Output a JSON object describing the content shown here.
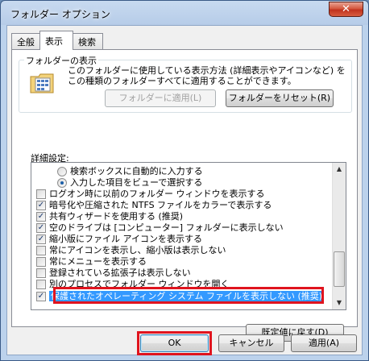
{
  "window": {
    "title": "フォルダー オプション",
    "close_label": "✕"
  },
  "tabs": [
    {
      "label": "全般",
      "active": false
    },
    {
      "label": "表示",
      "active": true
    },
    {
      "label": "検索",
      "active": false
    }
  ],
  "folder_views": {
    "group_label": "フォルダーの表示",
    "description": "このフォルダーに使用している表示方法 (詳細表示やアイコンなど) をこの種類のフォルダーすべてに適用することができます。",
    "apply_button": "フォルダーに適用(L)",
    "reset_button": "フォルダーをリセット(R)"
  },
  "advanced": {
    "label": "詳細設定:",
    "items": [
      {
        "type": "radio",
        "checked": false,
        "text": "検索ボックスに自動的に入力する"
      },
      {
        "type": "radio",
        "checked": true,
        "text": "入力した項目をビューで選択する"
      },
      {
        "type": "checkbox",
        "checked": false,
        "text": "ログオン時に以前のフォルダー ウィンドウを表示する"
      },
      {
        "type": "checkbox",
        "checked": true,
        "text": "暗号化や圧縮された NTFS ファイルをカラーで表示する"
      },
      {
        "type": "checkbox",
        "checked": true,
        "text": "共有ウィザードを使用する (推奨)"
      },
      {
        "type": "checkbox",
        "checked": true,
        "text": "空のドライブは [コンピューター] フォルダーに表示しない"
      },
      {
        "type": "checkbox",
        "checked": true,
        "text": "縮小版にファイル アイコンを表示する"
      },
      {
        "type": "checkbox",
        "checked": false,
        "text": "常にアイコンを表示し、縮小版は表示しない"
      },
      {
        "type": "checkbox",
        "checked": false,
        "text": "常にメニューを表示する"
      },
      {
        "type": "checkbox",
        "checked": false,
        "text": "登録されている拡張子は表示しない"
      },
      {
        "type": "checkbox",
        "checked": false,
        "text": "別のプロセスでフォルダー ウィンドウを開く"
      },
      {
        "type": "checkbox",
        "checked": true,
        "text": "保護されたオペレーティング システム ファイルを表示しない (推奨)"
      }
    ],
    "restore_button": "既定値に戻す(D)"
  },
  "footer": {
    "ok": "OK",
    "cancel": "キャンセル",
    "apply": "適用(A)"
  },
  "colors": {
    "highlight": "#e0141e",
    "selection": "#3399ff"
  }
}
